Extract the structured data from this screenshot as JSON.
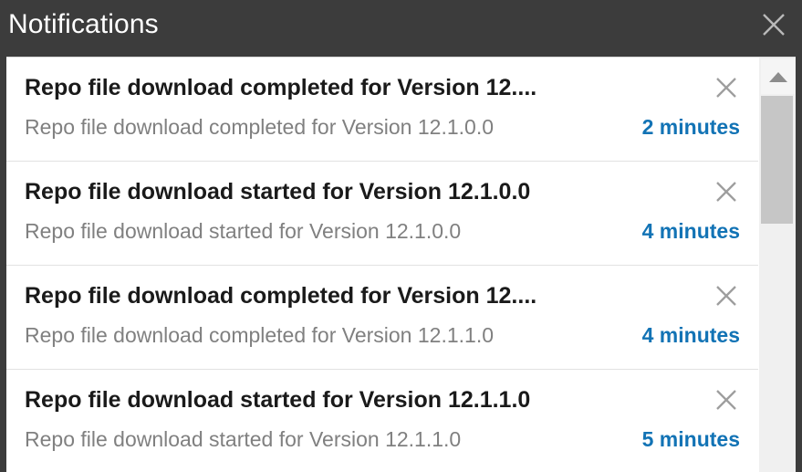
{
  "window": {
    "title": "Notifications",
    "close_icon": "close-icon",
    "header_bg": "#3c3c3c",
    "header_text_color": "#ffffff"
  },
  "colors": {
    "accent_time": "#1273b5",
    "title_text": "#1a1a1a",
    "body_text": "#808080",
    "divider": "#e2e2e2",
    "scrollbar_thumb": "#c6c6c6",
    "scrollbar_track": "#f0f0f0"
  },
  "notifications": [
    {
      "title": "Repo file download completed for Version 12....",
      "body": "Repo file download completed for Version 12.1.0.0",
      "time": "2 minutes",
      "dismiss_icon": "close-icon"
    },
    {
      "title": "Repo file download started for Version 12.1.0.0",
      "body": "Repo file download started for Version 12.1.0.0",
      "time": "4 minutes",
      "dismiss_icon": "close-icon"
    },
    {
      "title": "Repo file download completed for Version 12....",
      "body": "Repo file download completed for Version 12.1.1.0",
      "time": "4 minutes",
      "dismiss_icon": "close-icon"
    },
    {
      "title": "Repo file download started for Version 12.1.1.0",
      "body": "Repo file download started for Version 12.1.1.0",
      "time": "5 minutes",
      "dismiss_icon": "close-icon"
    }
  ],
  "scrollbar": {
    "up_arrow_icon": "caret-up-icon",
    "orientation": "vertical"
  }
}
